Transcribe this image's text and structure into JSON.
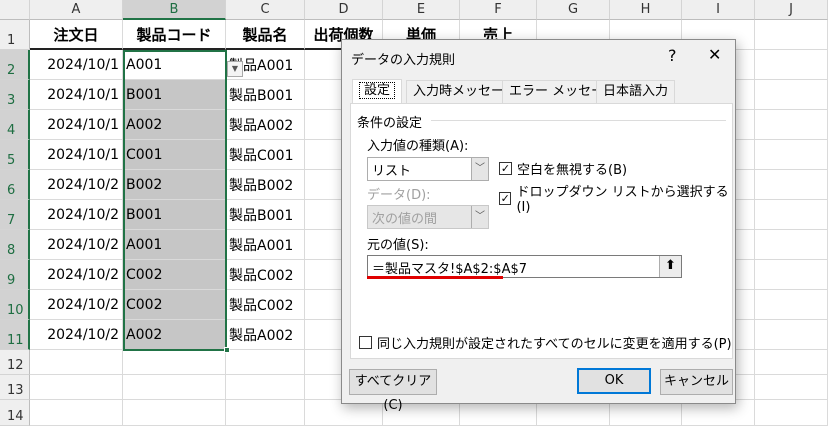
{
  "columns": [
    "A",
    "B",
    "C",
    "D",
    "E",
    "F",
    "G",
    "H",
    "I",
    "J"
  ],
  "rows": [
    "1",
    "2",
    "3",
    "4",
    "5",
    "6",
    "7",
    "8",
    "9",
    "10",
    "11",
    "12",
    "13",
    "14"
  ],
  "headers": [
    "注文日",
    "製品コード",
    "製品名",
    "出荷個数",
    "単価",
    "売上"
  ],
  "data": [
    [
      "2024/10/1",
      "A001",
      "製品A001"
    ],
    [
      "2024/10/1",
      "B001",
      "製品B001"
    ],
    [
      "2024/10/1",
      "A002",
      "製品A002"
    ],
    [
      "2024/10/1",
      "C001",
      "製品C001"
    ],
    [
      "2024/10/2",
      "B002",
      "製品B002"
    ],
    [
      "2024/10/2",
      "B001",
      "製品B001"
    ],
    [
      "2024/10/2",
      "A001",
      "製品A001"
    ],
    [
      "2024/10/2",
      "C002",
      "製品C002"
    ],
    [
      "2024/10/2",
      "C002",
      "製品C002"
    ],
    [
      "2024/10/2",
      "A002",
      "製品A002"
    ]
  ],
  "dialog": {
    "title": "データの入力規則",
    "help": "?",
    "close": "✕",
    "tabs": [
      "設定",
      "入力時メッセージ",
      "エラー メッセージ",
      "日本語入力"
    ],
    "group": "条件の設定",
    "allow_label": "入力値の種類(A):",
    "allow_value": "リスト",
    "data_label": "データ(D):",
    "data_value": "次の値の間",
    "ignore_blank": "空白を無視する(B)",
    "ignore_blank_checked": true,
    "dropdown": "ドロップダウン リストから選択する(I)",
    "dropdown_checked": true,
    "source_label": "元の値(S):",
    "source_value": "＝製品マスタ!$A$2:$A$7",
    "apply_all": "同じ入力規則が設定されたすべてのセルに変更を適用する(P)",
    "apply_all_checked": false,
    "clear_all": "すべてクリア(C)",
    "ok": "OK",
    "cancel": "キャンセル"
  },
  "colors": {
    "selection": "#217346",
    "annotation_underline": "#e00000",
    "accent": "#0078d7"
  }
}
